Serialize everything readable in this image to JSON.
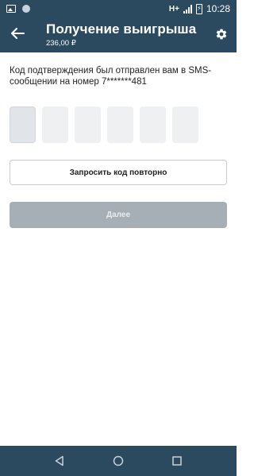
{
  "status_bar": {
    "network_label": "H+",
    "battery_icon": "battery-charging-icon",
    "time": "10:28",
    "notification_icons": [
      "image-icon",
      "circle-icon"
    ]
  },
  "header": {
    "title": "Получение выигрыша",
    "subtitle": "236,00 ₽",
    "back_icon": "arrow-left-icon",
    "settings_icon": "gear-icon"
  },
  "content": {
    "message": "Код подтверждения был отправлен вам в SMS-сообщении на номер 7*******481",
    "code_boxes": [
      "",
      "",
      "",
      "",
      "",
      ""
    ],
    "resend_label": "Запросить код повторно",
    "next_label": "Далее"
  },
  "nav_bar": {
    "items": [
      "back-triangle-icon",
      "home-circle-icon",
      "recents-square-icon"
    ]
  },
  "colors": {
    "primary": "#2b4a5f",
    "disabled_button": "#a7afb6",
    "code_box": "#eef0f2"
  }
}
